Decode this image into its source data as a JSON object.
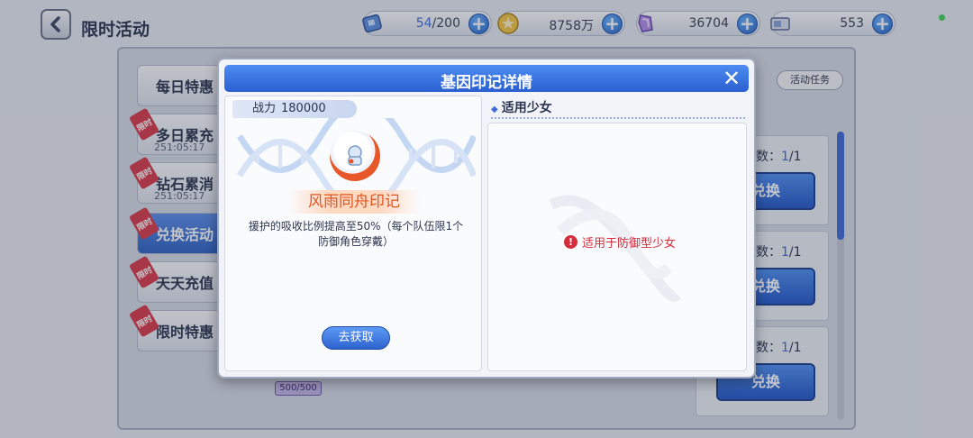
{
  "header": {
    "title": "限时活动",
    "resources": [
      {
        "icon": "ticket-icon",
        "current": "54",
        "max": "/200"
      },
      {
        "icon": "gold-coin-icon",
        "value": "8758万"
      },
      {
        "icon": "crystal-icon",
        "value": "36704"
      },
      {
        "icon": "voucher-icon",
        "value": "553"
      }
    ]
  },
  "sidebar": {
    "items": [
      {
        "label": "每日特惠",
        "badge": "",
        "timer": ""
      },
      {
        "label": "多日累充",
        "badge": "限时",
        "timer": "251:05:17"
      },
      {
        "label": "钻石累消",
        "badge": "限时",
        "timer": "251:05:17"
      },
      {
        "label": "兑换活动",
        "badge": "限时",
        "timer": ""
      },
      {
        "label": "天天充值",
        "badge": "限时",
        "timer": ""
      },
      {
        "label": "限时特惠",
        "badge": "限时",
        "timer": ""
      }
    ]
  },
  "background": {
    "task_label": "活动任务",
    "cards": [
      {
        "count_prefix": "数：",
        "count": "1",
        "total": "/1",
        "button": "兑换"
      },
      {
        "count_prefix": "数：",
        "count": "1",
        "total": "/1",
        "button": "兑换"
      },
      {
        "count_prefix": "数：",
        "count": "1",
        "total": "/1",
        "button": "兑换"
      }
    ],
    "item_count": "500/500"
  },
  "modal": {
    "title": "基因印记详情",
    "close_symbol": "✕",
    "power_label": "战力",
    "power_value": "180000",
    "imprint_name": "风雨同舟印记",
    "description": "援护的吸收比例提高至50%（每个队伍限1个防御角色穿戴）",
    "get_button": "去获取",
    "applicable_title": "适用少女",
    "warning_text": "适用于防御型少女"
  },
  "colors": {
    "accent": "#3f6ad6",
    "header_blue": "#2a5fd0",
    "warning_red": "#d42d3b",
    "imprint_orange": "#e0551f"
  }
}
